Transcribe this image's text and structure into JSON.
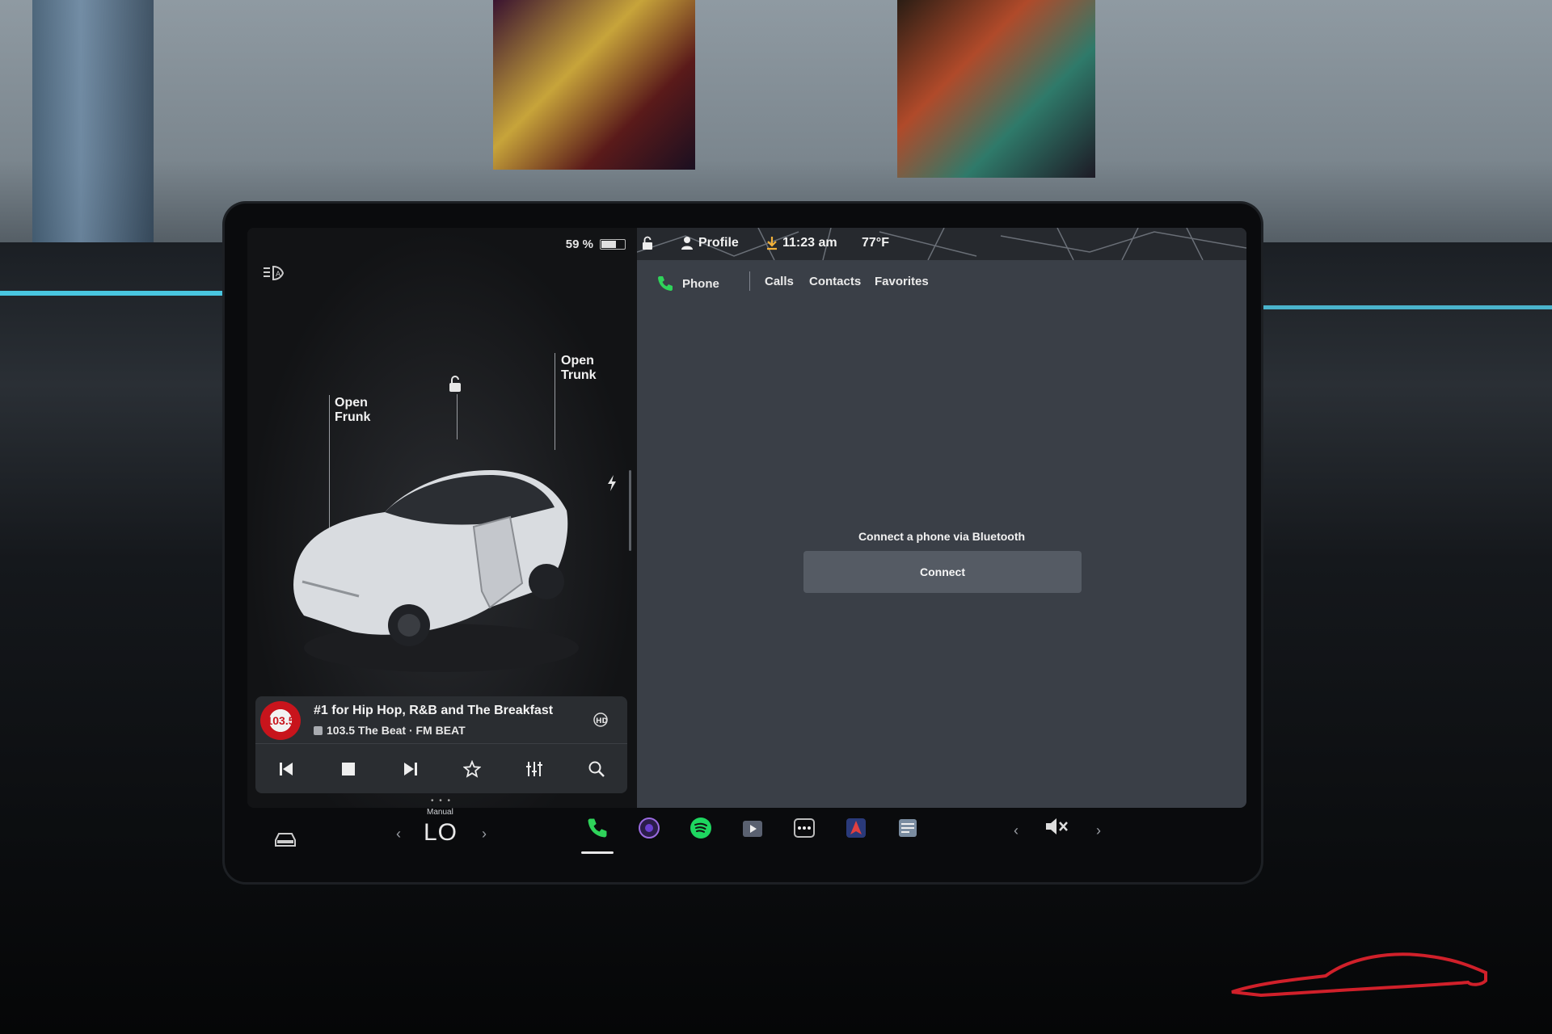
{
  "status": {
    "battery_percent": "59 %",
    "battery_level": 0.59,
    "profile_label": "Profile",
    "time": "11:23 am",
    "temperature": "77°F"
  },
  "vehicle": {
    "frunk_label_1": "Open",
    "frunk_label_2": "Frunk",
    "trunk_label_1": "Open",
    "trunk_label_2": "Trunk"
  },
  "media": {
    "station_logo_text": "103.5",
    "track_title": "#1 for Hip Hop, R&B and The Breakfast",
    "track_subtitle": "103.5 The Beat · FM BEAT"
  },
  "phone": {
    "app_label": "Phone",
    "tabs": [
      {
        "label": "Calls"
      },
      {
        "label": "Contacts"
      },
      {
        "label": "Favorites"
      }
    ],
    "connect_prompt": "Connect a phone via Bluetooth",
    "connect_button": "Connect"
  },
  "climate": {
    "mode": "Manual",
    "temperature_setting": "LO"
  },
  "colors": {
    "phone_green": "#2fd35a",
    "spotify_green": "#1ed760",
    "panel_bg": "#3a3f47",
    "connect_button_bg": "#555b64"
  },
  "dock_icons": [
    "car-icon",
    "phone-icon",
    "camera-icon",
    "spotify-icon",
    "theater-icon",
    "more-apps-icon",
    "navigation-icon",
    "notes-icon",
    "volume-mute-icon"
  ]
}
